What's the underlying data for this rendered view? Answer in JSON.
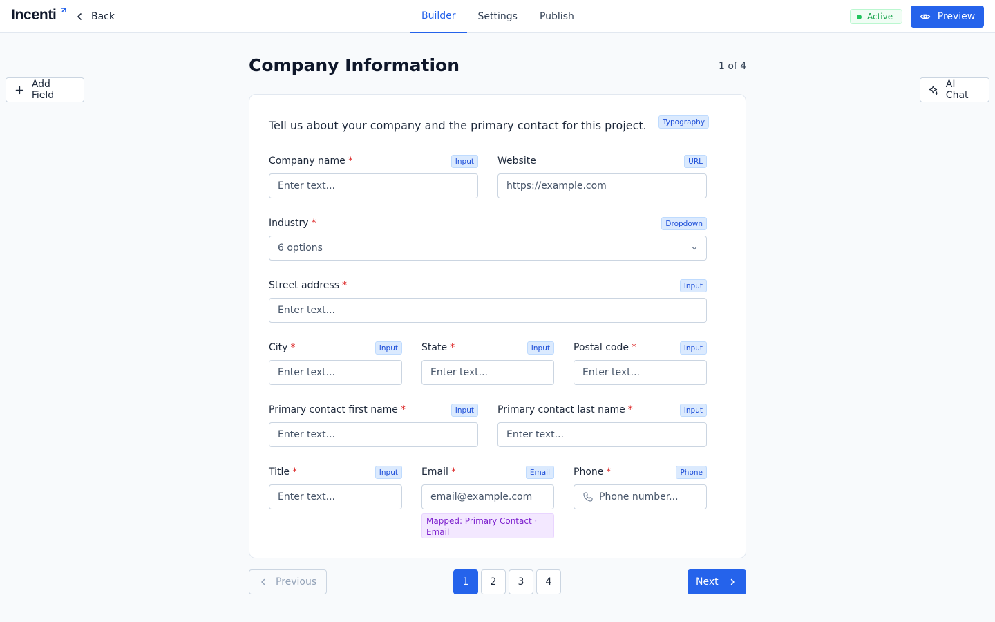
{
  "header": {
    "logo": "Incenti",
    "back_label": "Back",
    "tabs": [
      {
        "label": "Builder",
        "active": true
      },
      {
        "label": "Settings",
        "active": false
      },
      {
        "label": "Publish",
        "active": false
      }
    ],
    "status": "Active",
    "preview_label": "Preview"
  },
  "sidebar": {
    "add_field_label": "Add Field",
    "ai_chat_label": "AI Chat"
  },
  "page": {
    "title": "Company Information",
    "step": "1 of 4"
  },
  "form": {
    "intro": "Tell us about your company and the primary contact for this project.",
    "intro_badge": "Typography",
    "fields": {
      "company_name": {
        "label": "Company name",
        "badge": "Input",
        "placeholder": "Enter text...",
        "required": true
      },
      "website": {
        "label": "Website",
        "badge": "URL",
        "placeholder": "https://example.com",
        "required": false
      },
      "industry": {
        "label": "Industry",
        "badge": "Dropdown",
        "value": "6 options",
        "required": true
      },
      "street": {
        "label": "Street address",
        "badge": "Input",
        "placeholder": "Enter text...",
        "required": true
      },
      "city": {
        "label": "City",
        "badge": "Input",
        "placeholder": "Enter text...",
        "required": true
      },
      "state": {
        "label": "State",
        "badge": "Input",
        "placeholder": "Enter text...",
        "required": true
      },
      "postal": {
        "label": "Postal code",
        "badge": "Input",
        "placeholder": "Enter text...",
        "required": true
      },
      "first_name": {
        "label": "Primary contact first name",
        "badge": "Input",
        "placeholder": "Enter text...",
        "required": true
      },
      "last_name": {
        "label": "Primary contact last name",
        "badge": "Input",
        "placeholder": "Enter text...",
        "required": true
      },
      "title": {
        "label": "Title",
        "badge": "Input",
        "placeholder": "Enter text...",
        "required": true
      },
      "email": {
        "label": "Email",
        "badge": "Email",
        "placeholder": "email@example.com",
        "required": true,
        "mapped": "Mapped: Primary Contact · Email"
      },
      "phone": {
        "label": "Phone",
        "badge": "Phone",
        "placeholder": "Phone number...",
        "required": true
      }
    },
    "required_mark": "*"
  },
  "pagination": {
    "previous_label": "Previous",
    "next_label": "Next",
    "pages": [
      "1",
      "2",
      "3",
      "4"
    ],
    "current": "1"
  },
  "colors": {
    "accent": "#2563eb",
    "status_green": "#16a34a",
    "required_red": "#dc2626",
    "mapped_purple": "#7e22ce"
  },
  "icons": {
    "back": "chevron-left-icon",
    "preview": "eye-icon",
    "add_field": "plus-icon",
    "ai_chat": "sparkles-icon",
    "dropdown": "chevron-down-icon",
    "phone": "phone-icon",
    "prev": "chevron-left-icon",
    "next": "chevron-right-icon"
  }
}
